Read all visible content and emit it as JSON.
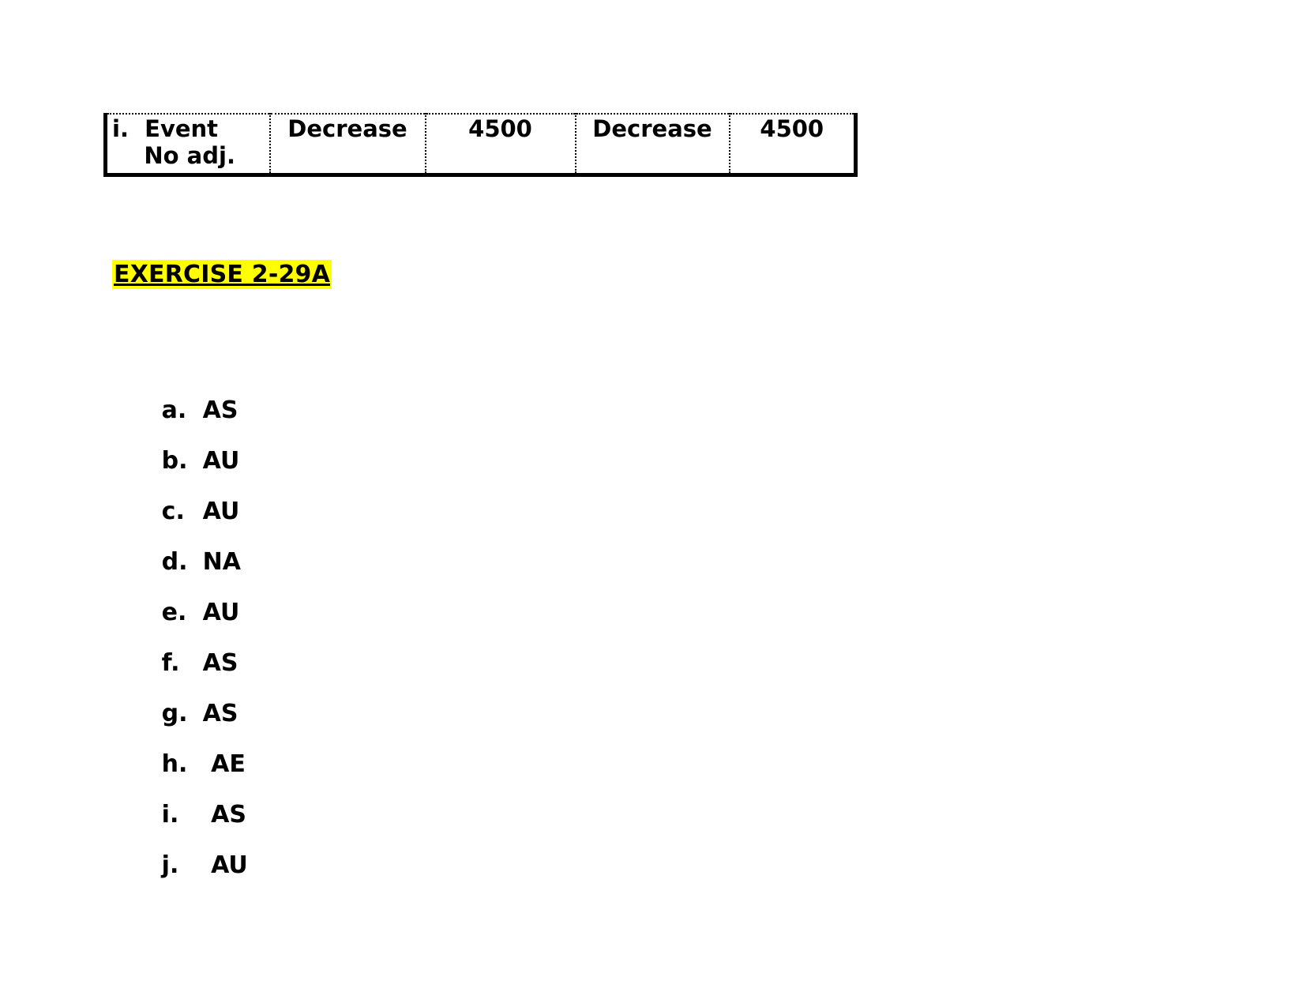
{
  "document": {
    "background_color": "#ffffff",
    "text_color": "#000000"
  },
  "event_table": {
    "columns": [
      {
        "key": "event",
        "align": "left"
      },
      {
        "key": "effect1",
        "align": "center"
      },
      {
        "key": "amount1",
        "align": "center"
      },
      {
        "key": "effect2",
        "align": "center"
      },
      {
        "key": "amount2",
        "align": "center"
      }
    ],
    "rows": [
      {
        "event_line1": "i.  Event",
        "event_line2": "    No adj.",
        "effect1": "Decrease",
        "amount1": "4500",
        "effect2": "Decrease",
        "amount2": "4500"
      }
    ],
    "border_color": "#000000"
  },
  "exercise": {
    "heading": "EXERCISE 2-29A",
    "highlight_color": "#ffff00",
    "underlined": true,
    "items": [
      {
        "marker": "a.",
        "value": "AS"
      },
      {
        "marker": "b.",
        "value": "AU"
      },
      {
        "marker": "c.",
        "value": "AU"
      },
      {
        "marker": "d.",
        "value": "NA"
      },
      {
        "marker": "e.",
        "value": "AU"
      },
      {
        "marker": "f.",
        "value": "AS"
      },
      {
        "marker": "g.",
        "value": "AS"
      },
      {
        "marker": "h.",
        "value": " AE"
      },
      {
        "marker": "i.",
        "value": " AS"
      },
      {
        "marker": "j.",
        "value": " AU"
      }
    ]
  }
}
